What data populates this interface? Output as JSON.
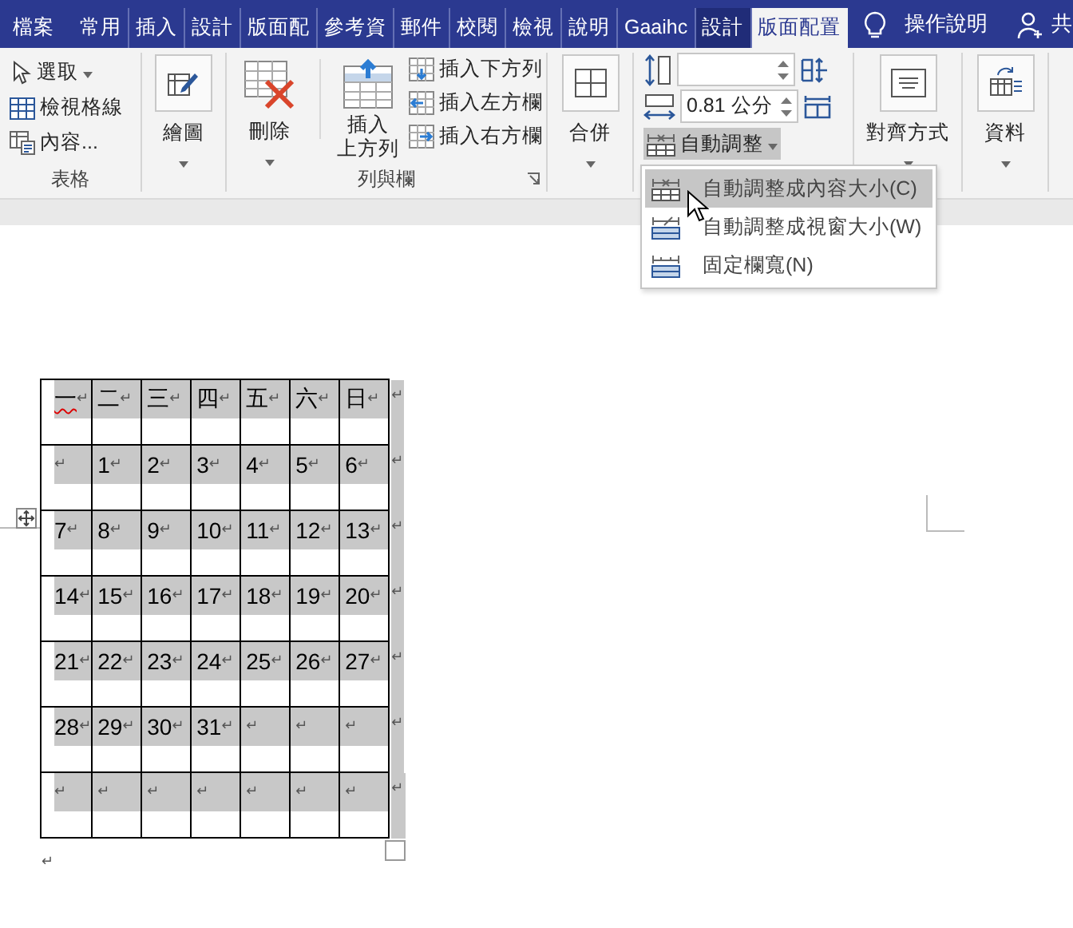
{
  "tabs": [
    {
      "label": "檔案",
      "selected": false,
      "kind": "file"
    },
    {
      "label": "常用",
      "selected": false,
      "kind": "normal"
    },
    {
      "label": "插入",
      "selected": false,
      "kind": "normal"
    },
    {
      "label": "設計",
      "selected": false,
      "kind": "normal"
    },
    {
      "label": "版面配",
      "selected": false,
      "kind": "normal"
    },
    {
      "label": "參考資",
      "selected": false,
      "kind": "normal"
    },
    {
      "label": "郵件",
      "selected": false,
      "kind": "normal"
    },
    {
      "label": "校閱",
      "selected": false,
      "kind": "normal"
    },
    {
      "label": "檢視",
      "selected": false,
      "kind": "normal"
    },
    {
      "label": "說明",
      "selected": false,
      "kind": "normal"
    },
    {
      "label": "Gaaihc",
      "selected": false,
      "kind": "normal"
    },
    {
      "label": "設計",
      "selected": false,
      "kind": "contextual"
    },
    {
      "label": "版面配置",
      "selected": true,
      "kind": "contextual"
    }
  ],
  "tell_me": "操作說明",
  "share": "共",
  "ribbon": {
    "table_group": {
      "label": "表格",
      "select": "選取",
      "view_gridlines": "檢視格線",
      "properties": "內容..."
    },
    "draw_group": {
      "draw": "繪圖"
    },
    "rows_columns_group": {
      "label": "列與欄",
      "delete": "刪除",
      "insert_above": [
        "插入",
        "上方列"
      ],
      "insert_below": "插入下方列",
      "insert_left": "插入左方欄",
      "insert_right": "插入右方欄"
    },
    "merge_group": {
      "merge": "合併"
    },
    "cell_size_group": {
      "width": "0.81 公分",
      "autofit": {
        "label": "自動調整",
        "expanded": true
      }
    },
    "alignment_group": {
      "alignment": "對齊方式"
    },
    "data_group": {
      "data": "資料"
    }
  },
  "autofit_menu": {
    "items": [
      {
        "label": "自動調整成內容大小(C)",
        "selected": true
      },
      {
        "label": "自動調整成視窗大小(W)",
        "selected": false
      },
      {
        "label": "固定欄寬(N)",
        "selected": false
      }
    ]
  },
  "table": {
    "selected": true,
    "rows": [
      {
        "cells": [
          {
            "text": "一",
            "mark": "↵",
            "spell_error": true
          },
          {
            "text": "二",
            "mark": "↵"
          },
          {
            "text": "三",
            "mark": "↵"
          },
          {
            "text": "四",
            "mark": "↵"
          },
          {
            "text": "五",
            "mark": "↵"
          },
          {
            "text": "六",
            "mark": "↵"
          },
          {
            "text": "日",
            "mark": "↵"
          }
        ],
        "end_mark": "↵"
      },
      {
        "cells": [
          {
            "mark": "↵"
          },
          {
            "text": "1",
            "mark": "↵"
          },
          {
            "text": "2",
            "mark": "↵"
          },
          {
            "text": "3",
            "mark": "↵"
          },
          {
            "text": "4",
            "mark": "↵"
          },
          {
            "text": "5",
            "mark": "↵"
          },
          {
            "text": "6",
            "mark": "↵"
          }
        ],
        "end_mark": "↵"
      },
      {
        "cells": [
          {
            "text": "7",
            "mark": "↵"
          },
          {
            "text": "8",
            "mark": "↵"
          },
          {
            "text": "9",
            "mark": "↵"
          },
          {
            "text": "10",
            "mark": "↵"
          },
          {
            "text": "11",
            "mark": "↵"
          },
          {
            "text": "12",
            "mark": "↵"
          },
          {
            "text": "13",
            "mark": "↵"
          }
        ],
        "end_mark": "↵"
      },
      {
        "cells": [
          {
            "text": "14",
            "mark": "↵"
          },
          {
            "text": "15",
            "mark": "↵"
          },
          {
            "text": "16",
            "mark": "↵"
          },
          {
            "text": "17",
            "mark": "↵"
          },
          {
            "text": "18",
            "mark": "↵"
          },
          {
            "text": "19",
            "mark": "↵"
          },
          {
            "text": "20",
            "mark": "↵"
          }
        ],
        "end_mark": "↵"
      },
      {
        "cells": [
          {
            "text": "21",
            "mark": "↵"
          },
          {
            "text": "22",
            "mark": "↵"
          },
          {
            "text": "23",
            "mark": "↵"
          },
          {
            "text": "24",
            "mark": "↵"
          },
          {
            "text": "25",
            "mark": "↵"
          },
          {
            "text": "26",
            "mark": "↵"
          },
          {
            "text": "27",
            "mark": "↵"
          }
        ],
        "end_mark": "↵"
      },
      {
        "cells": [
          {
            "text": "28",
            "mark": "↵"
          },
          {
            "text": "29",
            "mark": "↵"
          },
          {
            "text": "30",
            "mark": "↵"
          },
          {
            "text": "31",
            "mark": "↵"
          },
          {
            "mark": "↵"
          },
          {
            "mark": "↵"
          },
          {
            "mark": "↵"
          }
        ],
        "end_mark": "↵"
      },
      {
        "cells": [
          {
            "mark": "↵"
          },
          {
            "mark": "↵"
          },
          {
            "mark": "↵"
          },
          {
            "mark": "↵"
          },
          {
            "mark": "↵"
          },
          {
            "mark": "↵"
          },
          {
            "mark": "↵"
          }
        ],
        "end_mark": "↵"
      }
    ]
  },
  "paragraph_mark": "↵"
}
